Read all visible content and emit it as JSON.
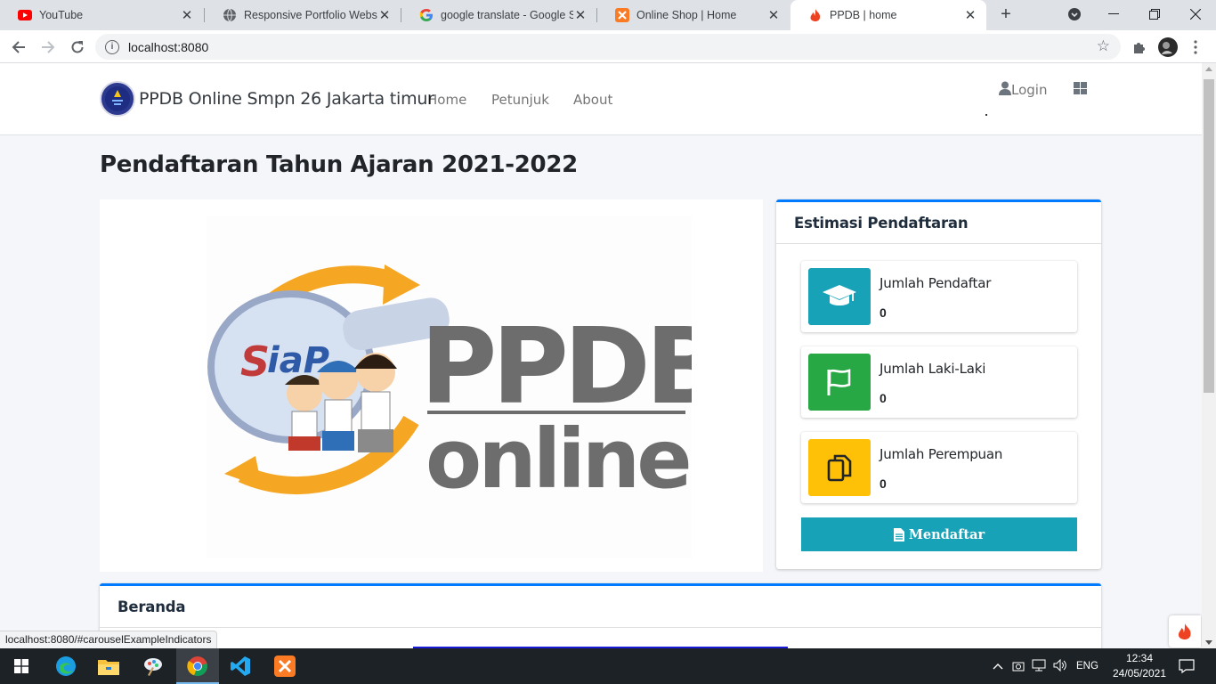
{
  "browser": {
    "tabs": [
      {
        "title": "YouTube",
        "icon": "youtube-icon"
      },
      {
        "title": "Responsive Portfolio Website",
        "icon": "globe-icon"
      },
      {
        "title": "google translate - Google Se",
        "icon": "google-icon"
      },
      {
        "title": "Online Shop | Home",
        "icon": "xampp-icon"
      },
      {
        "title": "PPDB | home",
        "icon": "codeigniter-icon",
        "active": true
      }
    ],
    "url": "localhost:8080",
    "status_url": "localhost:8080/#carouselExampleIndicators"
  },
  "navbar": {
    "brand": "PPDB Online Smpn 26 Jakarta timur",
    "links": [
      "Home",
      "Petunjuk",
      "About"
    ],
    "login_label": "Login"
  },
  "page": {
    "title": "Pendaftaran Tahun Ajaran 2021-2022"
  },
  "estimasi": {
    "title": "Estimasi Pendaftaran",
    "boxes": [
      {
        "label": "Jumlah Pendaftar",
        "value": "0",
        "color": "#17a2b8",
        "icon": "graduation-cap-icon"
      },
      {
        "label": "Jumlah Laki-Laki",
        "value": "0",
        "color": "#28a745",
        "icon": "flag-icon"
      },
      {
        "label": "Jumlah Perempuan",
        "value": "0",
        "color": "#ffc107",
        "icon": "copy-icon"
      }
    ],
    "button_label": "Mendaftar"
  },
  "beranda": {
    "title": "Beranda"
  },
  "taskbar": {
    "time": "12:34",
    "date": "24/05/2021",
    "lang": "ENG"
  },
  "colors": {
    "primary": "#007bff",
    "info": "#17a2b8",
    "success": "#28a745",
    "warning": "#ffc107"
  }
}
